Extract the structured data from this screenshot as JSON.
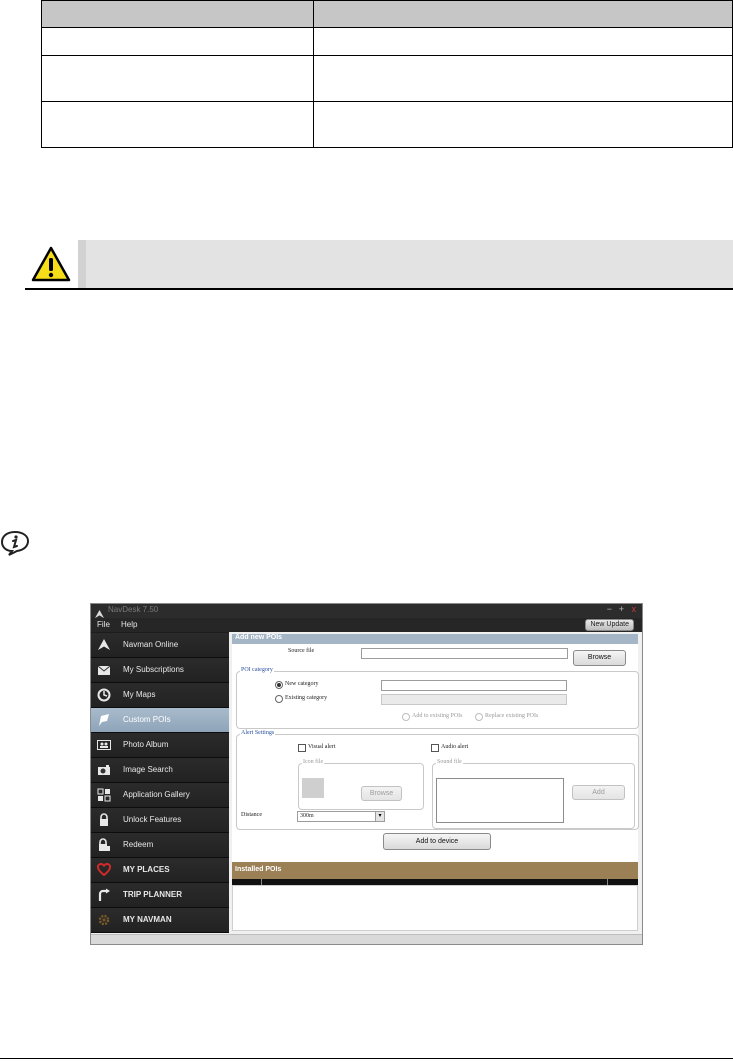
{
  "table": {
    "rows": [
      {
        "c1": "",
        "c2": ""
      },
      {
        "c1": "",
        "c2": ""
      },
      {
        "c1": "",
        "c2": ""
      },
      {
        "c1": "",
        "c2": ""
      }
    ]
  },
  "warning": {
    "text": ""
  },
  "app": {
    "title": "NavDesk 7.50",
    "window_controls": [
      "−",
      "+",
      "x"
    ],
    "menu": [
      "File",
      "Help"
    ],
    "new_update": "New Update",
    "sidebar": [
      {
        "label": "Navman Online",
        "icon": "navman-logo-icon",
        "active": false
      },
      {
        "label": "My Subscriptions",
        "icon": "envelope-icon",
        "active": false
      },
      {
        "label": "My Maps",
        "icon": "compass-icon",
        "active": false
      },
      {
        "label": "Custom POIs",
        "icon": "poi-flag-icon",
        "active": true
      },
      {
        "label": "Photo Album",
        "icon": "photo-album-icon",
        "active": false
      },
      {
        "label": "Image Search",
        "icon": "camera-icon",
        "active": false
      },
      {
        "label": "Application Gallery",
        "icon": "app-grid-icon",
        "active": false
      },
      {
        "label": "Unlock Features",
        "icon": "lock-icon",
        "active": false
      },
      {
        "label": "Redeem",
        "icon": "redeem-lock-icon",
        "active": false
      },
      {
        "label": "MY PLACES",
        "icon": "heart-icon",
        "active": false
      },
      {
        "label": "TRIP PLANNER",
        "icon": "route-icon",
        "active": false
      },
      {
        "label": "MY NAVMAN",
        "icon": "gear-icon",
        "active": false
      }
    ],
    "add_panel": {
      "header": "Add new POIs",
      "source_file_label": "Source file",
      "browse": "Browse",
      "poi_category_legend": "POI category",
      "new_category": "New category",
      "existing_category": "Existing category",
      "add_to_existing": "Add to existing POIs",
      "replace_existing": "Replace existing POIs",
      "alert_settings_legend": "Alert Settings",
      "visual_alert": "Visual alert",
      "audio_alert": "Audio alert",
      "icon_file_legend": "Icon file",
      "sound_file_legend": "Sound file",
      "icon_browse": "Browse",
      "add": "Add",
      "distance_label": "Distance",
      "distance_value": "300m",
      "add_to_device": "Add to device"
    },
    "installed_header": "Installed POIs"
  },
  "colors": {
    "sidebar_active": "#9cb0c3",
    "panel_header": "#a4b5c6",
    "installed_header": "#9b7f55",
    "heart": "#d22a2a",
    "warning_yellow": "#f6dd1a"
  }
}
